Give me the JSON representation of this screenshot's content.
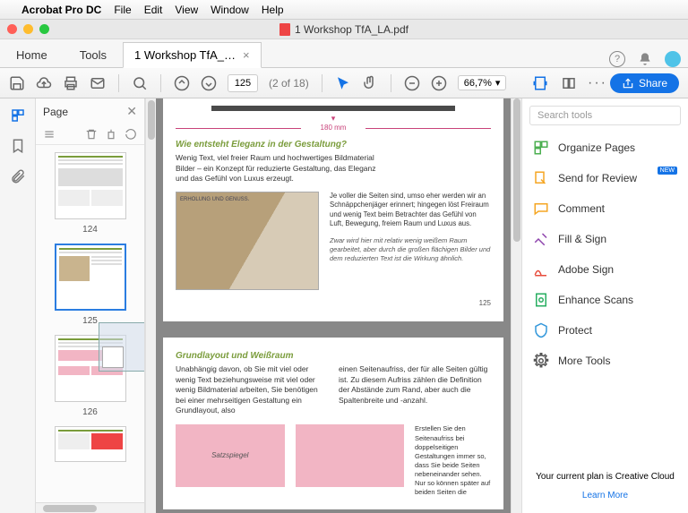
{
  "menubar": {
    "apple": "",
    "app": "Acrobat Pro DC",
    "items": [
      "File",
      "Edit",
      "View",
      "Window",
      "Help"
    ]
  },
  "window": {
    "title": "1  Workshop TfA_LA.pdf"
  },
  "tabs": {
    "home": "Home",
    "tools": "Tools",
    "doc": "1  Workshop TfA_…"
  },
  "toolbar": {
    "page_value": "125",
    "page_total": "(2 of 18)",
    "zoom": "66,7%",
    "share": "Share"
  },
  "thumbs": {
    "header": "Page",
    "nums": [
      "124",
      "125",
      "126"
    ]
  },
  "doc": {
    "dim_label": "180 mm",
    "h1": "Wie entsteht Eleganz in der Gestaltung?",
    "p1": "Wenig Text, viel freier Raum und hochwertiges Bildmaterial Bilder – ein Konzept für reduzierte Gestaltung, das Eleganz und das Gefühl von Luxus erzeugt.",
    "img_caption": "ERHOLUNG UND GENUSS.",
    "side1": "Je voller die Seiten sind, umso eher werden wir an Schnäppchenjäger erinnert; hingegen löst Freiraum und wenig Text beim Betrachter das Gefühl von Luft, Bewegung, freiem Raum und Luxus aus.",
    "side2": "Zwar wird hier mit relativ wenig weißem Raum gearbeitet, aber durch die großen flächigen Bilder und dem reduzierten Text ist die Wirkung ähnlich.",
    "pgnum": "125",
    "h2": "Grundlayout und Weißraum",
    "col_l": "Unabhängig davon, ob Sie mit viel oder wenig Text beziehungsweise mit viel oder wenig Bildmaterial arbeiten, Sie benötigen bei einer mehrseitigen Gestaltung ein Grundlayout, also",
    "col_r": "einen Seitenaufriss, der für alle Seiten gültig ist. Zu diesem Aufriss zählen die Definition der Abstände zum Rand, aber auch die Spaltenbreite und -anzahl.",
    "pink1": "Satzspiegel",
    "col_r2": "Erstellen Sie den Seitenaufriss bei doppelseitigen Gestaltungen immer so, dass Sie beide Seiten nebeneinander sehen. Nur so können später auf beiden Seiten die"
  },
  "rhs": {
    "search_ph": "Search tools",
    "tools": [
      "Organize Pages",
      "Send for Review",
      "Comment",
      "Fill & Sign",
      "Adobe Sign",
      "Enhance Scans",
      "Protect",
      "More Tools"
    ],
    "new": "NEW",
    "plan": "Your current plan is Creative Cloud",
    "learn": "Learn More"
  }
}
